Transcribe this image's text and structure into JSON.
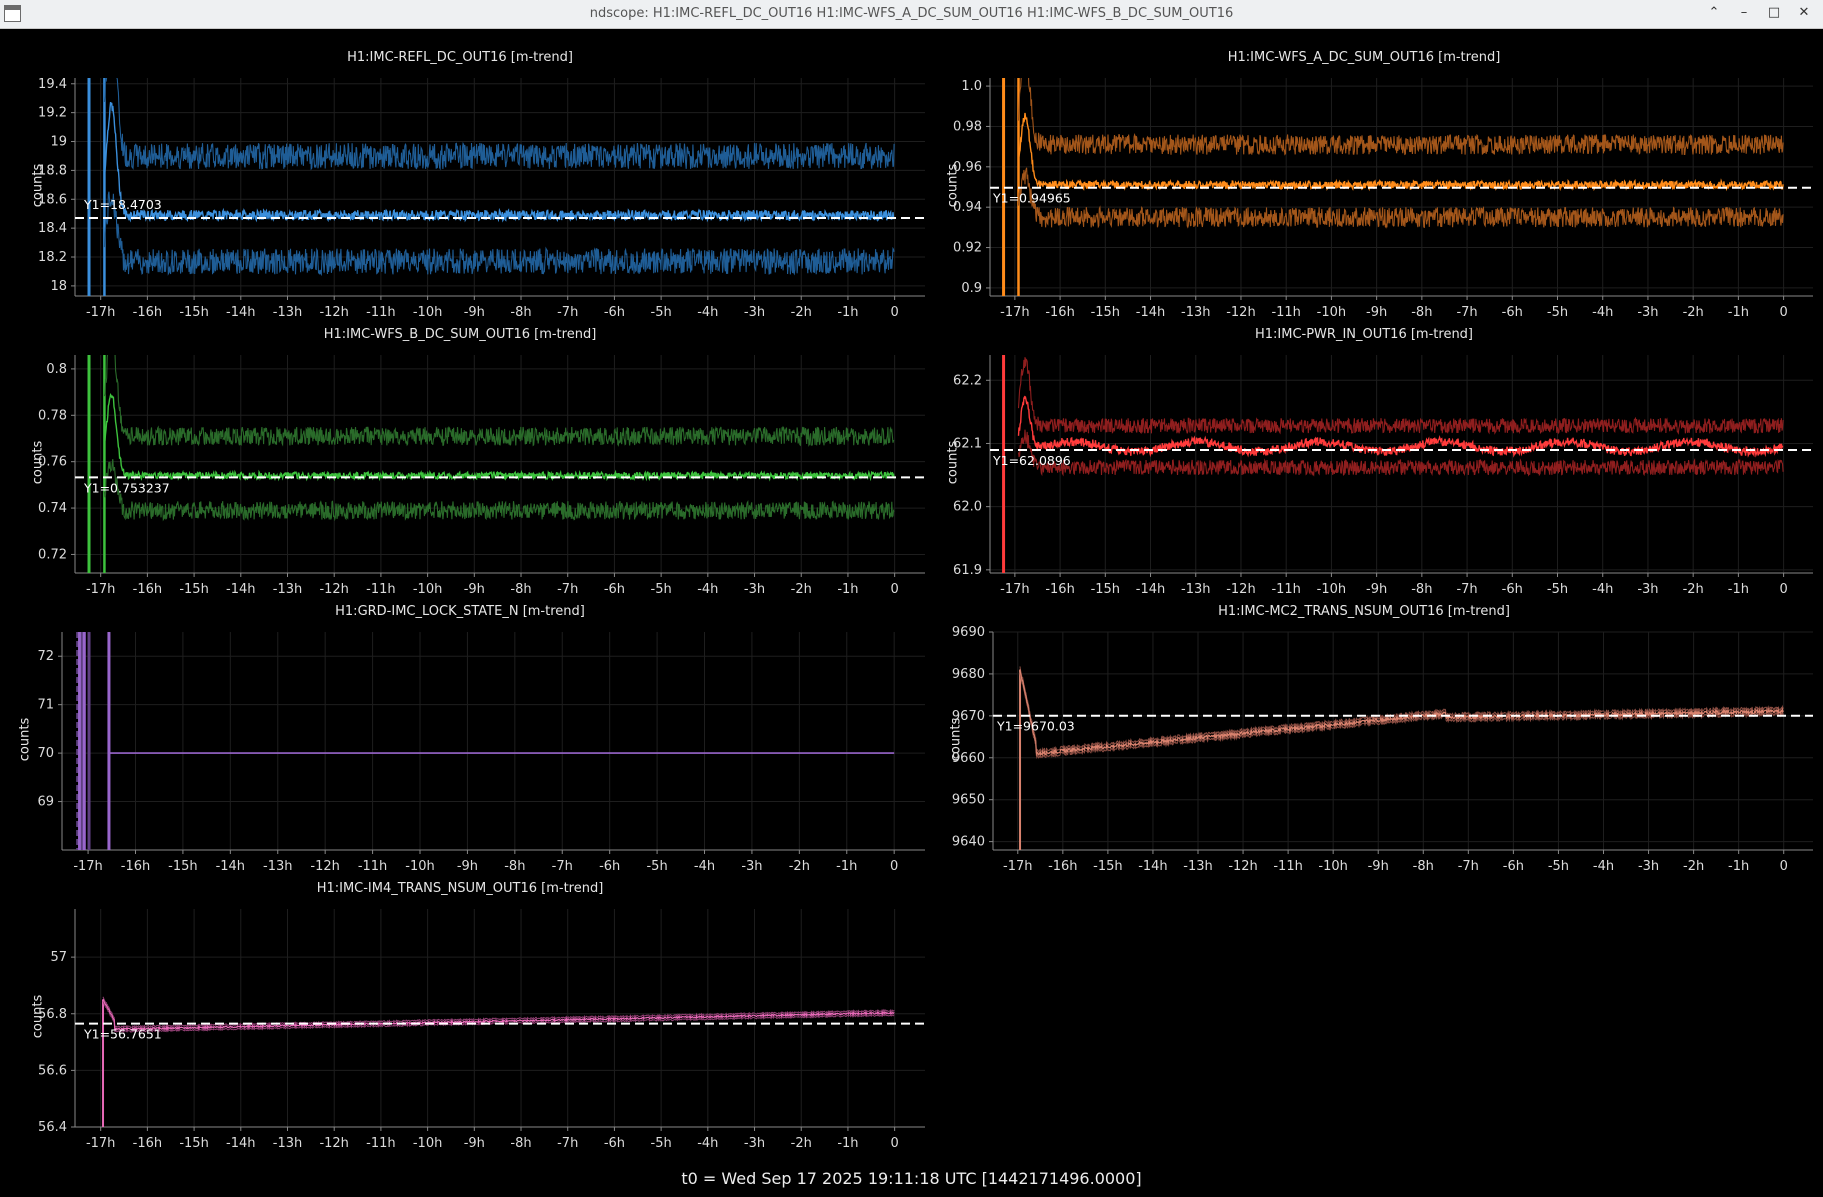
{
  "window": {
    "title": "ndscope: H1:IMC-REFL_DC_OUT16 H1:IMC-WFS_A_DC_SUM_OUT16 H1:IMC-WFS_B_DC_SUM_OUT16",
    "controls": {
      "up": "⌃",
      "minimize": "–",
      "maximize": "□",
      "close": "✕"
    }
  },
  "footer": "t0 = Wed Sep 17 2025 19:11:18 UTC [1442171496.0000]",
  "xticks": [
    "-17h",
    "-16h",
    "-15h",
    "-14h",
    "-13h",
    "-12h",
    "-11h",
    "-10h",
    "-9h",
    "-8h",
    "-7h",
    "-6h",
    "-5h",
    "-4h",
    "-3h",
    "-2h",
    "-1h",
    "0"
  ],
  "plots": [
    {
      "id": "refl",
      "title": "H1:IMC-REFL_DC_OUT16 [m-trend]",
      "ylabel": "counts",
      "color": "#3b8fdc",
      "dark": "#1f5d96",
      "ylim": [
        17.93,
        19.44
      ],
      "yticks": [
        "18",
        "18.2",
        "18.4",
        "18.6",
        "18.8",
        "19",
        "19.2",
        "19.4"
      ],
      "ytick_values": [
        18,
        18.2,
        18.4,
        18.6,
        18.8,
        19,
        19.2,
        19.4
      ],
      "cursor": {
        "value": 18.4703,
        "label": "Y1=18.4703"
      },
      "mean": 18.49,
      "env_hi": 18.9,
      "env_lo": 18.17,
      "noise_mean": 0.035,
      "noise_env": 0.09,
      "spike_peak": 19.25,
      "settle_start": -16.7
    },
    {
      "id": "wfsa",
      "title": "H1:IMC-WFS_A_DC_SUM_OUT16 [m-trend]",
      "ylabel": "counts",
      "color": "#ff8c1a",
      "dark": "#a3561a",
      "ylim": [
        0.896,
        1.004
      ],
      "yticks": [
        "0.9",
        "0.92",
        "0.94",
        "0.96",
        "0.98",
        "1.0"
      ],
      "ytick_values": [
        0.9,
        0.92,
        0.94,
        0.96,
        0.98,
        1.0
      ],
      "cursor": {
        "value": 0.94965,
        "label": "Y1=0.94965"
      },
      "mean": 0.951,
      "env_hi": 0.971,
      "env_lo": 0.935,
      "noise_mean": 0.002,
      "noise_env": 0.005,
      "spike_peak": 0.985,
      "settle_start": -16.7
    },
    {
      "id": "wfsb",
      "title": "H1:IMC-WFS_B_DC_SUM_OUT16 [m-trend]",
      "ylabel": "counts",
      "color": "#3dc23d",
      "dark": "#2a6b2a",
      "ylim": [
        0.712,
        0.806
      ],
      "yticks": [
        "0.72",
        "0.74",
        "0.76",
        "0.78",
        "0.8"
      ],
      "ytick_values": [
        0.72,
        0.74,
        0.76,
        0.78,
        0.8
      ],
      "cursor": {
        "value": 0.753237,
        "label": "Y1=0.753237"
      },
      "mean": 0.754,
      "env_hi": 0.771,
      "env_lo": 0.739,
      "noise_mean": 0.0015,
      "noise_env": 0.004,
      "spike_peak": 0.789,
      "settle_start": -16.7
    },
    {
      "id": "pwr",
      "title": "H1:IMC-PWR_IN_OUT16 [m-trend]",
      "ylabel": "counts",
      "color": "#ff3b3b",
      "dark": "#8f1e1e",
      "ylim": [
        61.895,
        62.24
      ],
      "yticks": [
        "61.9",
        "62.0",
        "62.1",
        "62.2"
      ],
      "ytick_values": [
        61.9,
        62.0,
        62.1,
        62.2
      ],
      "cursor": {
        "value": 62.0896,
        "label": "Y1=62.0896"
      },
      "mean": 62.095,
      "env_hi": 62.128,
      "env_lo": 62.062,
      "noise_mean": 0.007,
      "noise_env": 0.012,
      "spike_peak": 62.175,
      "settle_start": -16.7
    },
    {
      "id": "grd",
      "title": "H1:GRD-IMC_LOCK_STATE_N [m-trend]",
      "ylabel": "counts",
      "color": "#9966cc",
      "dark": "#5e3f80",
      "ylim": [
        68.0,
        72.5
      ],
      "yticks": [
        "69",
        "70",
        "71",
        "72"
      ],
      "ytick_values": [
        69,
        70,
        71,
        72
      ],
      "cursor": null,
      "mean": 70.0
    },
    {
      "id": "mc2",
      "title": "H1:IMC-MC2_TRANS_NSUM_OUT16 [m-trend]",
      "ylabel": "counts",
      "color": "#d9826e",
      "dark": "#8a4d42",
      "ylim": [
        9638,
        9690
      ],
      "yticks": [
        "9640",
        "9650",
        "9660",
        "9670",
        "9680",
        "9690"
      ],
      "ytick_values": [
        9640,
        9650,
        9660,
        9670,
        9680,
        9690
      ],
      "cursor": {
        "value": 9670.03,
        "label": "Y1=9670.03"
      },
      "mean": 9670,
      "spike_peak": 9681
    },
    {
      "id": "im4",
      "title": "H1:IMC-IM4_TRANS_NSUM_OUT16 [m-trend]",
      "ylabel": "counts",
      "color": "#e86ab8",
      "dark": "#8f3f72",
      "ylim": [
        56.4,
        57.17
      ],
      "yticks": [
        "56.4",
        "56.6",
        "56.8",
        "57"
      ],
      "ytick_values": [
        56.4,
        56.6,
        56.8,
        57
      ],
      "cursor": {
        "value": 56.7651,
        "label": "Y1=56.7651"
      },
      "mean": 56.77,
      "spike_peak": 56.85
    }
  ]
}
